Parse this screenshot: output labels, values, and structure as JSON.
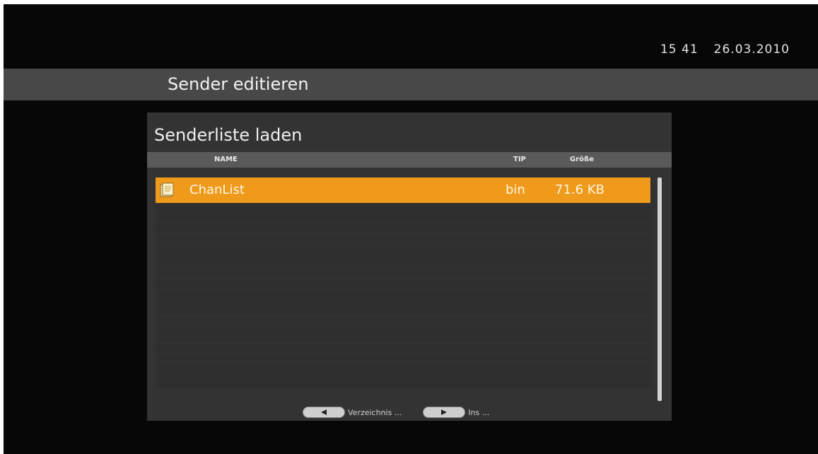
{
  "clock": {
    "time": "15 41",
    "date": "26.03.2010"
  },
  "header": {
    "title": "Sender editieren"
  },
  "panel": {
    "title": "Senderliste laden",
    "columns": {
      "name": "NAME",
      "type": "TIP",
      "size": "Größe"
    },
    "files": [
      {
        "icon": "file-icon",
        "name": "ChanList",
        "type": "bin",
        "size": "71.6 KB",
        "selected": true
      }
    ]
  },
  "footer": {
    "hints": [
      {
        "key_icon": "arrow-left-icon",
        "label": "Verzeichnis ..."
      },
      {
        "key_icon": "arrow-right-icon",
        "label": "Ins ..."
      }
    ]
  },
  "colors": {
    "accent": "#ef9a1a",
    "panel": "#333333",
    "bar": "#484848"
  }
}
